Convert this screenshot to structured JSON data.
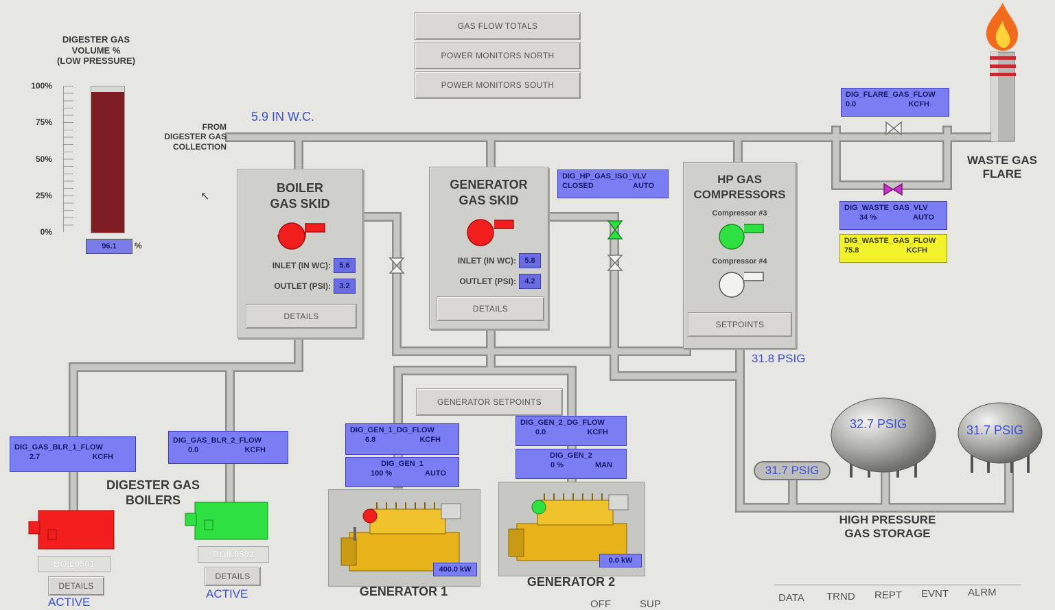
{
  "nav": {
    "gas_flow_totals": "GAS FLOW TOTALS",
    "power_monitors_north": "POWER MONITORS NORTH",
    "power_monitors_south": "POWER MONITORS SOUTH"
  },
  "digester_volume": {
    "title": "DIGESTER GAS\nVOLUME %\n(LOW PRESSURE)",
    "ticks": [
      "100%",
      "75%",
      "50%",
      "25%",
      "0%"
    ],
    "value": "96.1",
    "level_fraction": 0.961,
    "unit": "%"
  },
  "from_label": "FROM\nDIGESTER GAS\nCOLLECTION",
  "header_pressure": "5.9 IN W.C.",
  "boiler_skid": {
    "title": "BOILER\nGAS SKID",
    "inlet_label": "INLET (IN WC):",
    "inlet_value": "5.6",
    "outlet_label": "OUTLET (PSI):",
    "outlet_value": "3.2",
    "details": "DETAILS"
  },
  "generator_skid": {
    "title": "GENERATOR\nGAS SKID",
    "inlet_label": "INLET (IN WC):",
    "inlet_value": "5.8",
    "outlet_label": "OUTLET (PSI):",
    "outlet_value": "4.2",
    "details": "DETAILS"
  },
  "hp_iso_valve": {
    "name": "DIG_HP_GAS_ISO_VLV",
    "state": "CLOSED",
    "mode": "AUTO"
  },
  "hp_compressors": {
    "title": "HP GAS\nCOMPRESSORS",
    "comp3": "Compressor #3",
    "comp4": "Compressor #4",
    "setpoints": "SETPOINTS",
    "pressure": "31.8 PSIG"
  },
  "flare_flow": {
    "name": "DIG_FLARE_GAS_FLOW",
    "value": "0.0",
    "unit": "KCFH"
  },
  "waste_valve": {
    "name": "DIG_WASTE_GAS_VLV",
    "value": "34 %",
    "mode": "AUTO"
  },
  "waste_flow": {
    "name": "DIG_WASTE_GAS_FLOW",
    "value": "75.8",
    "unit": "KCFH"
  },
  "flare_label": "WASTE GAS\nFLARE",
  "boiler1_flow": {
    "name": "DIG_GAS_BLR_1_FLOW",
    "value": "2.7",
    "unit": "KCFH"
  },
  "boiler2_flow": {
    "name": "DIG_GAS_BLR_2_FLOW",
    "value": "0.0",
    "unit": "KCFH"
  },
  "boilers_label": "DIGESTER GAS\nBOILERS",
  "boiler1": {
    "id": "BOIL0501",
    "details": "DETAILS",
    "status": "ACTIVE"
  },
  "boiler2": {
    "id": "BOIL0502",
    "details": "DETAILS",
    "status": "ACTIVE"
  },
  "gen_setpoints": "GENERATOR SETPOINTS",
  "gen1_flow": {
    "name": "DIG_GEN_1_DG_FLOW",
    "value": "6.8",
    "unit": "KCFH"
  },
  "gen1_ctrl": {
    "name": "DIG_GEN_1",
    "value": "100 %",
    "mode": "AUTO"
  },
  "gen2_flow": {
    "name": "DIG_GEN_2_DG_FLOW",
    "value": "0.0",
    "unit": "KCFH"
  },
  "gen2_ctrl": {
    "name": "DIG_GEN_2",
    "value": "0 %",
    "mode": "MAN"
  },
  "gen1": {
    "power": "400.0 kW",
    "label": "GENERATOR 1"
  },
  "gen2": {
    "power": "0.0 kW",
    "label": "GENERATOR 2"
  },
  "storage": {
    "pressure_small": "31.7 PSIG",
    "sphere1": "32.7 PSIG",
    "sphere2": "31.7 PSIG",
    "label": "HIGH PRESSURE\nGAS STORAGE"
  },
  "tabs_left": [
    "OFF",
    "SUP"
  ],
  "tabs_right": [
    "DATA",
    "TRND",
    "REPT",
    "EVNT",
    "ALRM"
  ],
  "colors": {
    "running": "#29e03a",
    "stopped": "#f21e1e",
    "tag_blue": "#7b7ef2",
    "tag_yellow": "#f2f22a",
    "pipe": "#bdbdba",
    "pressure_text": "#3b4fd8"
  }
}
